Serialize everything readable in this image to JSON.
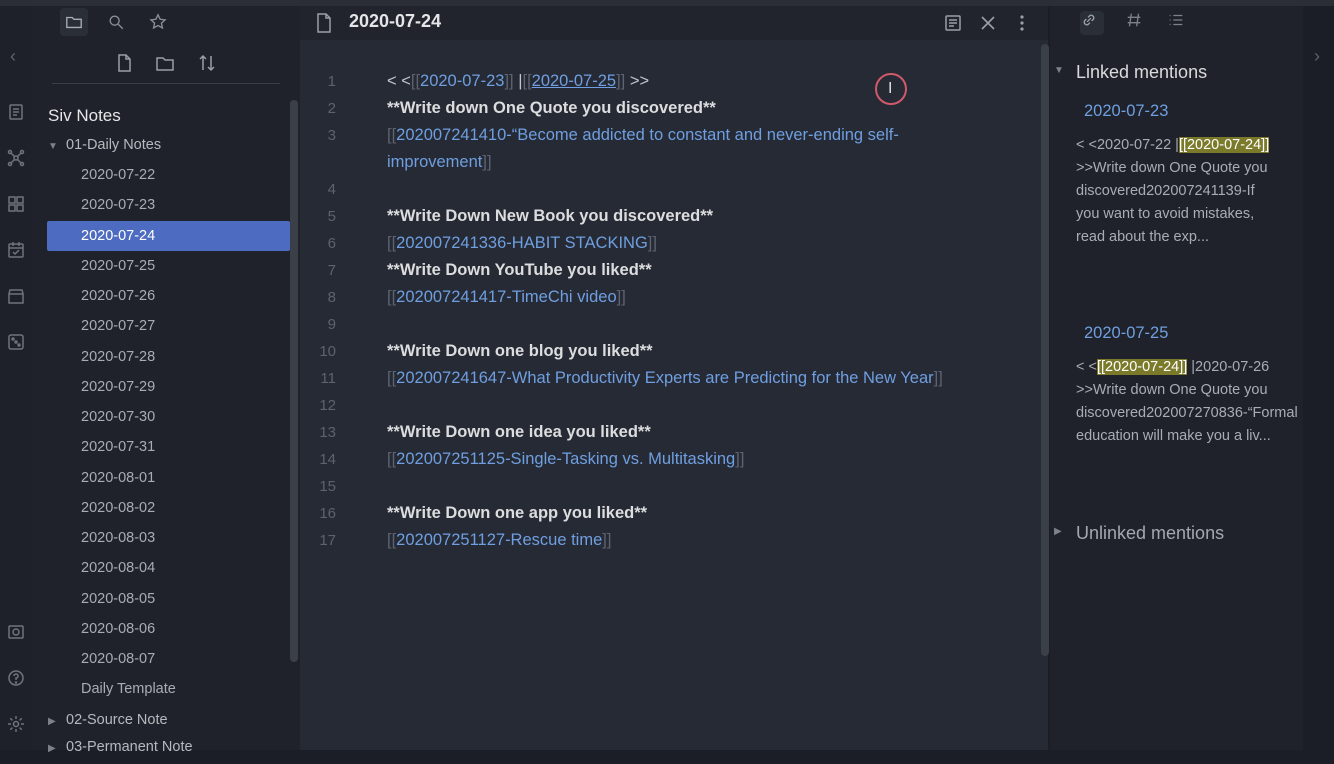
{
  "editor": {
    "title": "2020-07-24",
    "lines": [
      {
        "n": "1",
        "parts": [
          {
            "t": "< <",
            "c": "plain"
          },
          {
            "t": "[[",
            "c": "br"
          },
          {
            "t": "2020-07-23",
            "c": "lnk"
          },
          {
            "t": "]]",
            "c": "br"
          },
          {
            "t": " |",
            "c": "plain"
          },
          {
            "t": "[[",
            "c": "br"
          },
          {
            "t": "2020-07-25",
            "c": "lnk-u"
          },
          {
            "t": "]]",
            "c": "br"
          },
          {
            "t": " >>",
            "c": "plain"
          }
        ]
      },
      {
        "n": "2",
        "parts": [
          {
            "t": "**Write down One Quote you discovered**",
            "c": "bold"
          }
        ]
      },
      {
        "n": "3",
        "parts": [
          {
            "t": "[[",
            "c": "br"
          },
          {
            "t": "202007241410-“Become addicted to constant and never-ending self-",
            "c": "lnk"
          }
        ]
      },
      {
        "n": "",
        "parts": [
          {
            "t": "improvement",
            "c": "lnk"
          },
          {
            "t": "]]",
            "c": "br"
          }
        ]
      },
      {
        "n": "4",
        "parts": []
      },
      {
        "n": "5",
        "parts": [
          {
            "t": "**Write Down New Book you discovered**",
            "c": "bold"
          }
        ]
      },
      {
        "n": "6",
        "parts": [
          {
            "t": "[[",
            "c": "br"
          },
          {
            "t": "202007241336-HABIT STACKING",
            "c": "lnk"
          },
          {
            "t": "]]",
            "c": "br"
          }
        ]
      },
      {
        "n": "7",
        "parts": [
          {
            "t": "**Write Down YouTube you liked**",
            "c": "bold"
          }
        ]
      },
      {
        "n": "8",
        "parts": [
          {
            "t": "[[",
            "c": "br"
          },
          {
            "t": "202007241417-TimeChi video",
            "c": "lnk"
          },
          {
            "t": "]]",
            "c": "br"
          }
        ]
      },
      {
        "n": "9",
        "parts": []
      },
      {
        "n": "10",
        "parts": [
          {
            "t": "**Write Down one blog you liked**",
            "c": "bold"
          }
        ]
      },
      {
        "n": "11",
        "parts": [
          {
            "t": "[[",
            "c": "br"
          },
          {
            "t": "202007241647-What Productivity Experts are Predicting for the New Year",
            "c": "lnk"
          },
          {
            "t": "]]",
            "c": "br"
          }
        ]
      },
      {
        "n": "12",
        "parts": []
      },
      {
        "n": "13",
        "parts": [
          {
            "t": "**Write Down one idea you liked**",
            "c": "bold"
          }
        ]
      },
      {
        "n": "14",
        "parts": [
          {
            "t": "[[",
            "c": "br"
          },
          {
            "t": "202007251125-Single-Tasking vs. Multitasking",
            "c": "lnk"
          },
          {
            "t": "]]",
            "c": "br"
          }
        ]
      },
      {
        "n": "15",
        "parts": []
      },
      {
        "n": "16",
        "parts": [
          {
            "t": "**Write Down one app you liked**",
            "c": "bold"
          }
        ]
      },
      {
        "n": "17",
        "parts": [
          {
            "t": "[[",
            "c": "br"
          },
          {
            "t": "202007251127-Rescue time",
            "c": "lnk"
          },
          {
            "t": "]]",
            "c": "br"
          }
        ]
      }
    ]
  },
  "sidebar": {
    "vault_name": "Siv Notes",
    "folders": {
      "daily": "01-Daily Notes",
      "source": "02-Source Note",
      "permanent": "03-Permanent Note"
    },
    "files": [
      "2020-07-22",
      "2020-07-23",
      "2020-07-24",
      "2020-07-25",
      "2020-07-26",
      "2020-07-27",
      "2020-07-28",
      "2020-07-29",
      "2020-07-30",
      "2020-07-31",
      "2020-08-01",
      "2020-08-02",
      "2020-08-03",
      "2020-08-04",
      "2020-08-05",
      "2020-08-06",
      "2020-08-07",
      "Daily Template"
    ],
    "active_file": "2020-07-24"
  },
  "backlinks": {
    "linked_heading": "Linked mentions",
    "unlinked_heading": "Unlinked mentions",
    "m1": {
      "title": "2020-07-23",
      "pre": "< <2020-07-22 |",
      "hl": "[[2020-07-24]]",
      "post": " >>Write down One Quote you discovered202007241139-If you want to avoid mistakes, read about the exp..."
    },
    "m2": {
      "title": "2020-07-25",
      "pre": "< <",
      "hl": "[[2020-07-24]]",
      "post": " |2020-07-26 >>Write down One Quote you discovered202007270836-“Formal education will make you a liv..."
    }
  },
  "colors": {
    "accent": "#4d6bc0",
    "link": "#6f9fe0",
    "highlight": "#7a7a2a",
    "background": "#262a35"
  },
  "icons": [
    "folder-icon",
    "search-icon",
    "star-icon",
    "new-note-icon",
    "new-folder-icon",
    "sort-icon",
    "file-icon",
    "reading-view-icon",
    "close-icon",
    "more-options-icon",
    "link-icon",
    "tag-icon",
    "outline-icon"
  ]
}
